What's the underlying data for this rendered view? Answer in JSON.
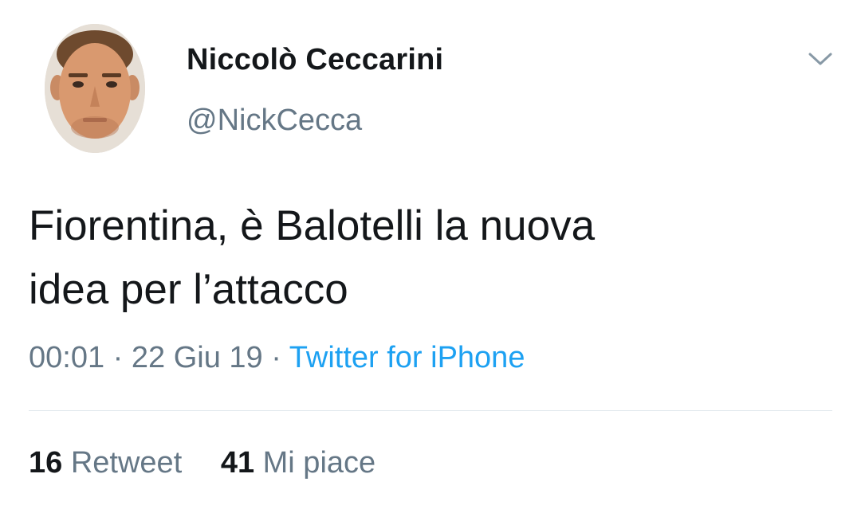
{
  "tweet": {
    "author": {
      "display_name": "Niccolò Ceccarini",
      "handle": "@NickCecca",
      "avatar_icon": "profile-photo"
    },
    "menu_icon": "chevron-down-icon",
    "text_line1": "Fiorentina, è Balotelli la nuova",
    "text_line2": "idea per l’attacco",
    "time": "00:01",
    "date": "22 Giu 19",
    "separator": "·",
    "source": "Twitter for iPhone",
    "stats": {
      "retweets_count": "16",
      "retweets_label": "Retweet",
      "likes_count": "41",
      "likes_label": "Mi piace"
    }
  },
  "colors": {
    "text": "#14171a",
    "muted": "#657786",
    "link": "#1da1f2",
    "divider": "#e1e8ed"
  }
}
